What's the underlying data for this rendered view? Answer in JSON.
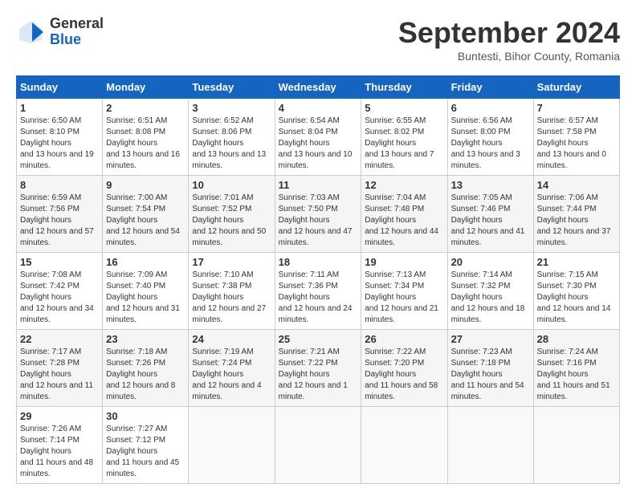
{
  "logo": {
    "general": "General",
    "blue": "Blue"
  },
  "title": "September 2024",
  "subtitle": "Buntesti, Bihor County, Romania",
  "weekdays": [
    "Sunday",
    "Monday",
    "Tuesday",
    "Wednesday",
    "Thursday",
    "Friday",
    "Saturday"
  ],
  "weeks": [
    [
      {
        "day": "1",
        "sunrise": "6:50 AM",
        "sunset": "8:10 PM",
        "daylight": "13 hours and 19 minutes."
      },
      {
        "day": "2",
        "sunrise": "6:51 AM",
        "sunset": "8:08 PM",
        "daylight": "13 hours and 16 minutes."
      },
      {
        "day": "3",
        "sunrise": "6:52 AM",
        "sunset": "8:06 PM",
        "daylight": "13 hours and 13 minutes."
      },
      {
        "day": "4",
        "sunrise": "6:54 AM",
        "sunset": "8:04 PM",
        "daylight": "13 hours and 10 minutes."
      },
      {
        "day": "5",
        "sunrise": "6:55 AM",
        "sunset": "8:02 PM",
        "daylight": "13 hours and 7 minutes."
      },
      {
        "day": "6",
        "sunrise": "6:56 AM",
        "sunset": "8:00 PM",
        "daylight": "13 hours and 3 minutes."
      },
      {
        "day": "7",
        "sunrise": "6:57 AM",
        "sunset": "7:58 PM",
        "daylight": "13 hours and 0 minutes."
      }
    ],
    [
      {
        "day": "8",
        "sunrise": "6:59 AM",
        "sunset": "7:56 PM",
        "daylight": "12 hours and 57 minutes."
      },
      {
        "day": "9",
        "sunrise": "7:00 AM",
        "sunset": "7:54 PM",
        "daylight": "12 hours and 54 minutes."
      },
      {
        "day": "10",
        "sunrise": "7:01 AM",
        "sunset": "7:52 PM",
        "daylight": "12 hours and 50 minutes."
      },
      {
        "day": "11",
        "sunrise": "7:03 AM",
        "sunset": "7:50 PM",
        "daylight": "12 hours and 47 minutes."
      },
      {
        "day": "12",
        "sunrise": "7:04 AM",
        "sunset": "7:48 PM",
        "daylight": "12 hours and 44 minutes."
      },
      {
        "day": "13",
        "sunrise": "7:05 AM",
        "sunset": "7:46 PM",
        "daylight": "12 hours and 41 minutes."
      },
      {
        "day": "14",
        "sunrise": "7:06 AM",
        "sunset": "7:44 PM",
        "daylight": "12 hours and 37 minutes."
      }
    ],
    [
      {
        "day": "15",
        "sunrise": "7:08 AM",
        "sunset": "7:42 PM",
        "daylight": "12 hours and 34 minutes."
      },
      {
        "day": "16",
        "sunrise": "7:09 AM",
        "sunset": "7:40 PM",
        "daylight": "12 hours and 31 minutes."
      },
      {
        "day": "17",
        "sunrise": "7:10 AM",
        "sunset": "7:38 PM",
        "daylight": "12 hours and 27 minutes."
      },
      {
        "day": "18",
        "sunrise": "7:11 AM",
        "sunset": "7:36 PM",
        "daylight": "12 hours and 24 minutes."
      },
      {
        "day": "19",
        "sunrise": "7:13 AM",
        "sunset": "7:34 PM",
        "daylight": "12 hours and 21 minutes."
      },
      {
        "day": "20",
        "sunrise": "7:14 AM",
        "sunset": "7:32 PM",
        "daylight": "12 hours and 18 minutes."
      },
      {
        "day": "21",
        "sunrise": "7:15 AM",
        "sunset": "7:30 PM",
        "daylight": "12 hours and 14 minutes."
      }
    ],
    [
      {
        "day": "22",
        "sunrise": "7:17 AM",
        "sunset": "7:28 PM",
        "daylight": "12 hours and 11 minutes."
      },
      {
        "day": "23",
        "sunrise": "7:18 AM",
        "sunset": "7:26 PM",
        "daylight": "12 hours and 8 minutes."
      },
      {
        "day": "24",
        "sunrise": "7:19 AM",
        "sunset": "7:24 PM",
        "daylight": "12 hours and 4 minutes."
      },
      {
        "day": "25",
        "sunrise": "7:21 AM",
        "sunset": "7:22 PM",
        "daylight": "12 hours and 1 minute."
      },
      {
        "day": "26",
        "sunrise": "7:22 AM",
        "sunset": "7:20 PM",
        "daylight": "11 hours and 58 minutes."
      },
      {
        "day": "27",
        "sunrise": "7:23 AM",
        "sunset": "7:18 PM",
        "daylight": "11 hours and 54 minutes."
      },
      {
        "day": "28",
        "sunrise": "7:24 AM",
        "sunset": "7:16 PM",
        "daylight": "11 hours and 51 minutes."
      }
    ],
    [
      {
        "day": "29",
        "sunrise": "7:26 AM",
        "sunset": "7:14 PM",
        "daylight": "11 hours and 48 minutes."
      },
      {
        "day": "30",
        "sunrise": "7:27 AM",
        "sunset": "7:12 PM",
        "daylight": "11 hours and 45 minutes."
      },
      null,
      null,
      null,
      null,
      null
    ]
  ]
}
